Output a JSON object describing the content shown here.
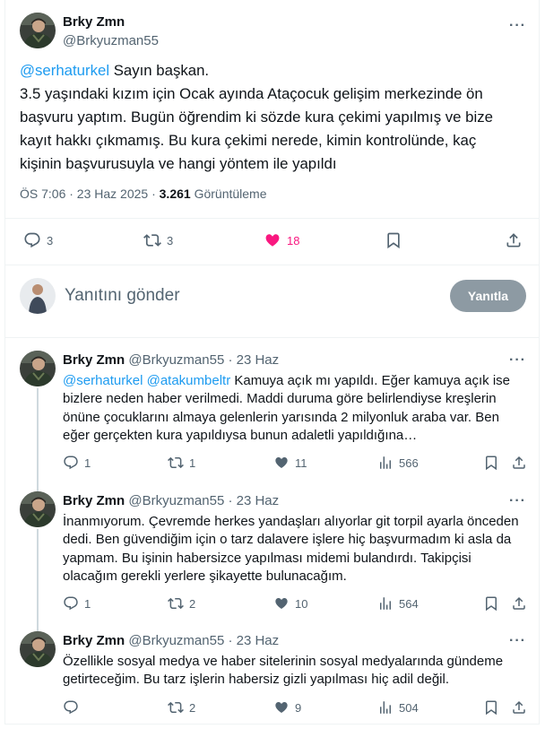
{
  "main_tweet": {
    "name": "Brky Zmn",
    "handle": "@Brkyuzman55",
    "mention": "@serhaturkel",
    "text": " Sayın başkan.\n3.5 yaşındaki kızım için Ocak ayında Ataçocuk gelişim merkezinde ön başvuru yaptım. Bugün öğrendim ki sözde kura çekimi yapılmış ve bize kayıt hakkı çıkmamış. Bu kura çekimi nerede, kimin kontrolünde, kaç kişinin başvurusuyla ve hangi yöntem ile yapıldı",
    "time": "ÖS 7:06 · 23 Haz 2025 · ",
    "views": "3.261",
    "views_label": " Görüntüleme",
    "replies": "3",
    "retweets": "3",
    "likes": "18"
  },
  "reply_box": {
    "placeholder": "Yanıtını gönder",
    "button": "Yanıtla"
  },
  "replies": [
    {
      "name": "Brky Zmn",
      "handle": "@Brkyuzman55 · 23 Haz",
      "mentions": "@serhaturkel @atakumbeltr",
      "text": " Kamuya açık mı yapıldı. Eğer kamuya açık ise bizlere neden haber verilmedi. Maddi duruma göre belirlendiyse kreşlerin önüne çocuklarını almaya gelenlerin yarısında 2 milyonluk araba var. Ben eğer gerçekten kura yapıldıysa bunun adaletli yapıldığına…",
      "replies": "1",
      "retweets": "1",
      "likes": "11",
      "views": "566"
    },
    {
      "name": "Brky Zmn",
      "handle": "@Brkyuzman55 · 23 Haz",
      "mentions": "",
      "text": "İnanmıyorum. Çevremde herkes yandaşları alıyorlar git torpil ayarla önceden dedi. Ben güvendiğim için o tarz dalavere işlere hiç başvurmadım ki asla da yapmam. Bu işinin habersizce yapılması midemi bulandırdı. Takipçisi olacağım gerekli yerlere şikayette bulunacağım.",
      "replies": "1",
      "retweets": "2",
      "likes": "10",
      "views": "564"
    },
    {
      "name": "Brky Zmn",
      "handle": "@Brkyuzman55 · 23 Haz",
      "mentions": "",
      "text": "Özellikle sosyal medya ve haber sitelerinin sosyal medyalarında gündeme getirteceğim. Bu tarz işlerin habersiz gizli yapılması hiç adil değil.",
      "replies": "",
      "retweets": "2",
      "likes": "9",
      "views": "504"
    }
  ],
  "colors": {
    "accent": "#1d9bf0",
    "like": "#f91880",
    "muted": "#536471"
  }
}
